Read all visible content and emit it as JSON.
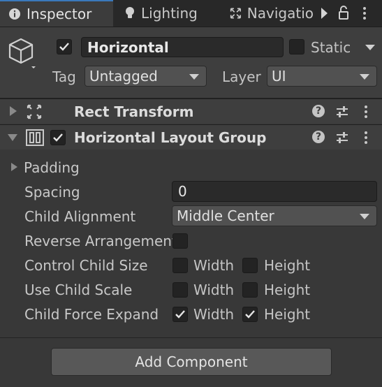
{
  "tabs": [
    {
      "label": "Inspector",
      "icon": "info-icon",
      "active": true
    },
    {
      "label": "Lighting",
      "icon": "lightbulb-icon",
      "active": false
    },
    {
      "label": "Navigatio",
      "icon": "navigation-icon",
      "active": false
    }
  ],
  "header": {
    "object_name": "Horizontal",
    "active_checked": true,
    "static_label": "Static",
    "static_checked": false,
    "tag_label": "Tag",
    "tag_value": "Untagged",
    "layer_label": "Layer",
    "layer_value": "UI"
  },
  "components": {
    "rect_transform": {
      "title": "Rect Transform",
      "expanded": false
    },
    "horizontal_layout_group": {
      "title": "Horizontal Layout Group",
      "enabled": true,
      "expanded": true
    }
  },
  "properties": {
    "padding_label": "Padding",
    "spacing_label": "Spacing",
    "spacing_value": "0",
    "child_alignment_label": "Child Alignment",
    "child_alignment_value": "Middle Center",
    "reverse_arrangement_label": "Reverse Arrangement",
    "reverse_arrangement_checked": false,
    "control_child_size_label": "Control Child Size",
    "use_child_scale_label": "Use Child Scale",
    "child_force_expand_label": "Child Force Expand",
    "width_label": "Width",
    "height_label": "Height",
    "control_child_size": {
      "width": false,
      "height": false
    },
    "use_child_scale": {
      "width": false,
      "height": false
    },
    "child_force_expand": {
      "width": true,
      "height": true
    }
  },
  "add_component_label": "Add Component",
  "colors": {
    "accent": "#3a79bb",
    "background": "#383838",
    "tabbar": "#282828"
  }
}
